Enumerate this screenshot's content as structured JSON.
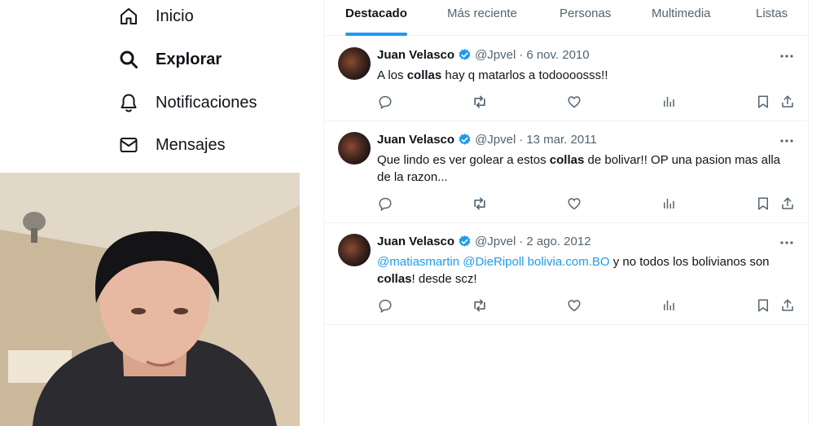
{
  "nav": {
    "items": [
      {
        "label": "Inicio",
        "icon": "home-icon"
      },
      {
        "label": "Explorar",
        "icon": "search-icon"
      },
      {
        "label": "Notificaciones",
        "icon": "bell-icon"
      },
      {
        "label": "Mensajes",
        "icon": "envelope-icon"
      }
    ],
    "active_index": 1
  },
  "tabs": [
    {
      "label": "Destacado"
    },
    {
      "label": "Más reciente"
    },
    {
      "label": "Personas"
    },
    {
      "label": "Multimedia"
    },
    {
      "label": "Listas"
    }
  ],
  "active_tab": 0,
  "tweets": [
    {
      "name": "Juan Velasco",
      "handle": "@Jpvel",
      "separator": "·",
      "date": "6 nov. 2010",
      "text": {
        "before": "A los ",
        "highlight": "collas",
        "after": " hay q matarlos a todoooosss!!"
      }
    },
    {
      "name": "Juan Velasco",
      "handle": "@Jpvel",
      "separator": "·",
      "date": "13 mar. 2011",
      "text": {
        "before": "Que lindo es ver golear a estos ",
        "highlight": "collas",
        "after": " de bolivar!! OP una pasion mas alla de la razon..."
      }
    },
    {
      "name": "Juan Velasco",
      "handle": "@Jpvel",
      "separator": "·",
      "date": "2 ago. 2012",
      "text": {
        "links": "@matiasmartin @DieRipoll bolivia.com.BO",
        "before": " y no todos los bolivianos son ",
        "highlight": "collas",
        "after": "! desde scz!"
      }
    }
  ],
  "colors": {
    "accent": "#1d9bf0",
    "text": "#0f1419",
    "muted": "#536471",
    "border": "#eff3f4"
  }
}
